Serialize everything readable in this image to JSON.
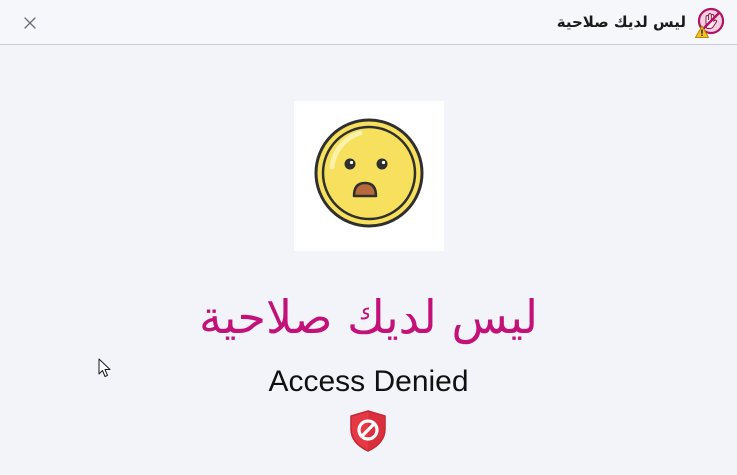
{
  "window": {
    "title": "ليس لديك صلاحية",
    "close_icon": "close-icon",
    "app_icon": "no-permission-warning-icon"
  },
  "content": {
    "emoji_icon": "sad-face-emoji-icon",
    "arabic_heading": "ليس لديك صلاحية",
    "english_heading": "Access Denied",
    "status_icon": "shield-block-icon"
  },
  "colors": {
    "accent": "#c2127a",
    "background": "#f3f4f9",
    "shield": "#e53945",
    "emoji_face": "#f6e05e"
  }
}
